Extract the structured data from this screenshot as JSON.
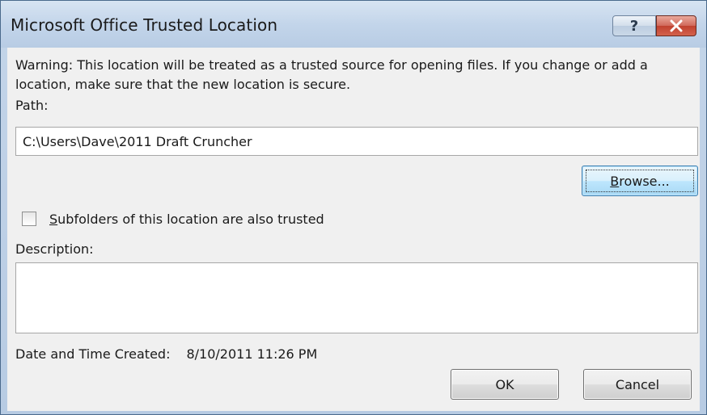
{
  "window": {
    "title": "Microsoft Office Trusted Location",
    "help_label": "?",
    "close_icon": "close-icon"
  },
  "warning_text": "Warning: This location will be treated as a trusted source for opening files. If you change or add a location, make sure that the new location is secure.",
  "path": {
    "label": "Path:",
    "value": "C:\\Users\\Dave\\2011 Draft Cruncher"
  },
  "browse": {
    "mnemonic": "B",
    "rest": "rowse..."
  },
  "subfolders": {
    "mnemonic": "S",
    "rest": "ubfolders of this location are also trusted",
    "checked": false
  },
  "description": {
    "label": "Description:",
    "value": ""
  },
  "created": {
    "label": "Date and Time Created:",
    "value": "8/10/2011 11:26 PM"
  },
  "buttons": {
    "ok": "OK",
    "cancel": "Cancel"
  },
  "colors": {
    "close_button": "#c0412f",
    "focused_button_border": "#3c7fb1"
  }
}
